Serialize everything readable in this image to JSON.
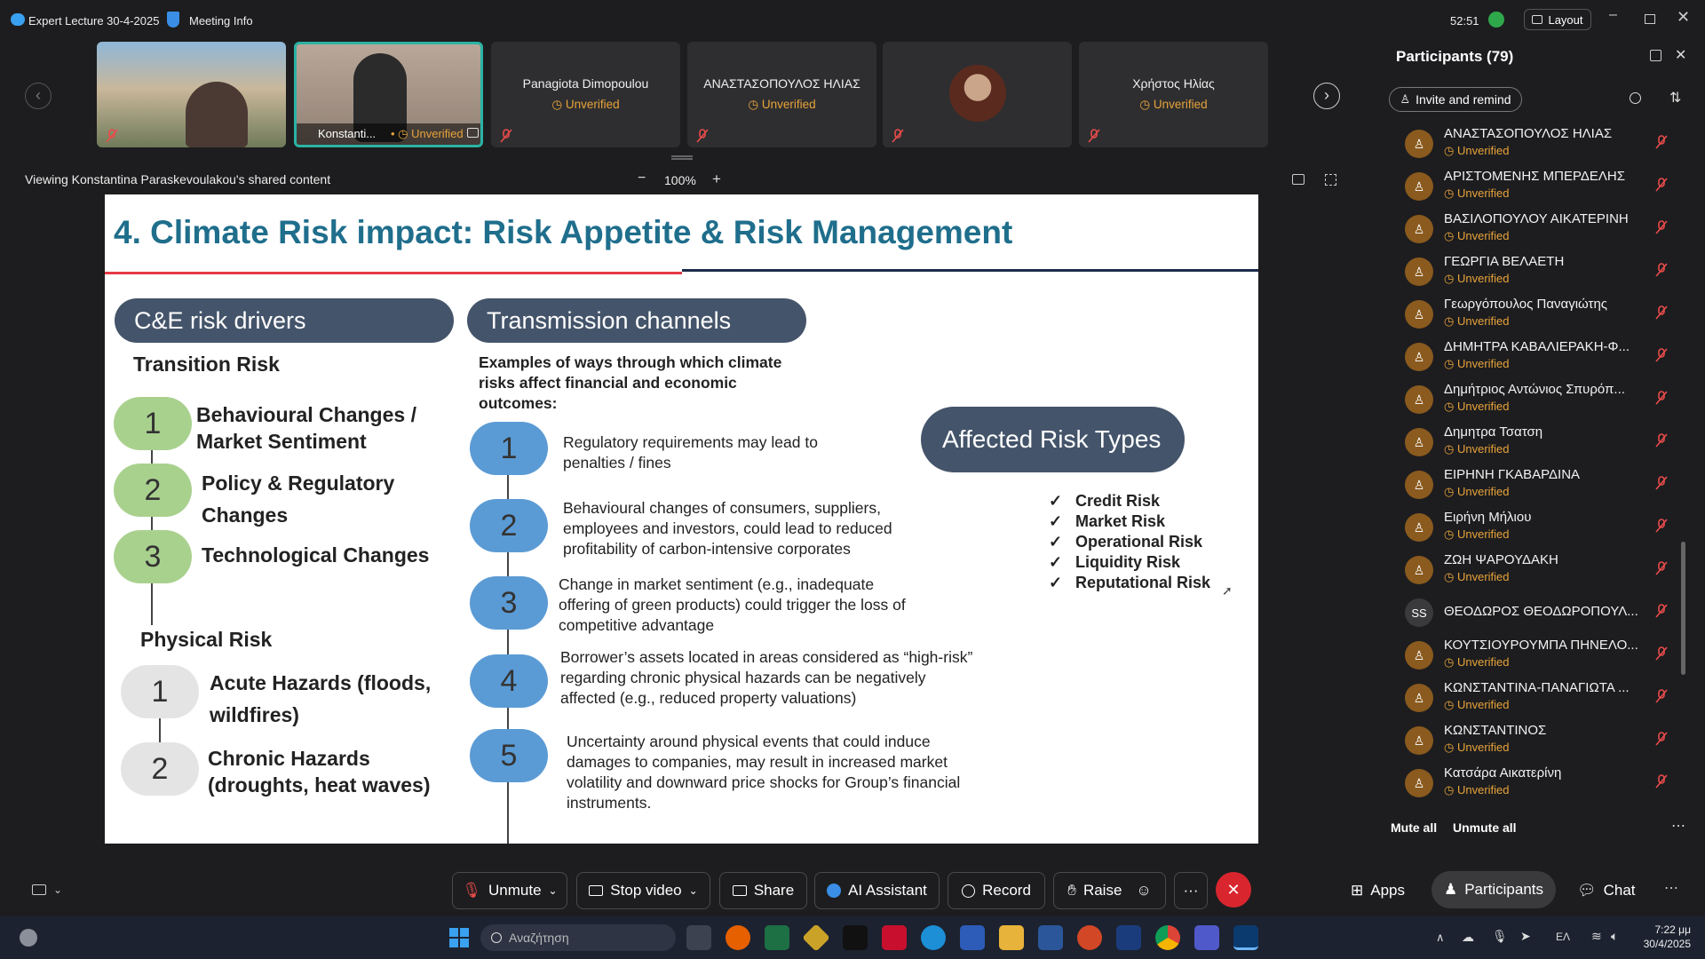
{
  "titlebar": {
    "app_title": "Expert Lecture 30-4-2025",
    "meeting_info": "Meeting Info",
    "timer": "52:51",
    "layout": "Layout"
  },
  "tiles": [
    {
      "name": ""
    },
    {
      "name": "Konstanti...",
      "status": "Unverified"
    },
    {
      "name": "Panagiota Dimopoulou",
      "status": "Unverified"
    },
    {
      "name": "ΑΝΑΣΤΑΣΟΠΟΥΛΟΣ ΗΛΙΑΣ",
      "status": "Unverified"
    },
    {
      "name": ""
    },
    {
      "name": "Χρήστος Ηλίας",
      "status": "Unverified"
    }
  ],
  "share": {
    "viewing": "Viewing Konstantina Paraskevoulakou's shared content",
    "zoom": "100%",
    "minus": "−",
    "plus": "+"
  },
  "slide": {
    "title": "4. Climate Risk impact: Risk Appetite & Risk Management",
    "drivers_header": "C&E risk drivers",
    "transition_title": "Transition Risk",
    "transition": [
      {
        "num": "1",
        "l1": "Behavioural Changes /",
        "l2": "Market Sentiment"
      },
      {
        "num": "2",
        "l1": "Policy & Regulatory",
        "l2": "Changes"
      },
      {
        "num": "3",
        "l1": "Technological Changes",
        "l2": ""
      }
    ],
    "physical_title": "Physical Risk",
    "physical": [
      {
        "num": "1",
        "l1": "Acute Hazards (floods,",
        "l2": "wildfires)"
      },
      {
        "num": "2",
        "l1": "Chronic Hazards",
        "l2": "(droughts, heat waves)"
      }
    ],
    "channels_header": "Transmission channels",
    "examples": "Examples of ways through which climate risks affect financial and economic outcomes:",
    "channels": [
      {
        "num": "1",
        "text": "Regulatory requirements may lead to penalties / fines"
      },
      {
        "num": "2",
        "text": "Behavioural changes of consumers, suppliers, employees and investors, could lead to reduced profitability of carbon-intensive corporates"
      },
      {
        "num": "3",
        "text": "Change in market sentiment (e.g., inadequate offering of green products) could trigger the loss of competitive advantage"
      },
      {
        "num": "4",
        "text": "Borrower’s assets located in areas considered as “high-risk” regarding chronic physical hazards can be negatively affected (e.g., reduced property valuations)"
      },
      {
        "num": "5",
        "text": "Uncertainty around physical events that could induce damages to companies, may result in increased market volatility and downward price shocks for Group’s financial instruments."
      }
    ],
    "affected_header": "Affected Risk Types",
    "risk_types": [
      "Credit Risk",
      "Market Risk",
      "Operational Risk",
      "Liquidity Risk",
      "Reputational Risk"
    ]
  },
  "participants": {
    "title": "Participants (79)",
    "invite": "Invite and remind",
    "list": [
      {
        "name": "ΑΝΑΣΤΑΣΟΠΟΥΛΟΣ ΗΛΙΑΣ",
        "status": "Unverified"
      },
      {
        "name": "ΑΡΙΣΤΟΜΕΝΗΣ ΜΠΕΡΔΕΛΗΣ",
        "status": "Unverified"
      },
      {
        "name": "ΒΑΣΙΛΟΠΟΥΛΟΥ ΑΙΚΑΤΕΡΙΝΗ",
        "status": "Unverified"
      },
      {
        "name": "ΓΕΩΡΓΙΑ ΒΕΛΑΕΤΗ",
        "status": "Unverified"
      },
      {
        "name": "Γεωργόπουλος Παναγιώτης",
        "status": "Unverified"
      },
      {
        "name": "ΔΗΜΗΤΡΑ ΚΑΒΑΛΙΕΡΑΚΗ-Φ...",
        "status": "Unverified"
      },
      {
        "name": "Δημήτριος Αντώνιος Σπυρόπ...",
        "status": "Unverified"
      },
      {
        "name": "Δημητρα Τσατση",
        "status": "Unverified"
      },
      {
        "name": "ΕΙΡΗΝΗ ΓΚΑΒΑΡΔΙΝΑ",
        "status": "Unverified"
      },
      {
        "name": "Ειρήνη Μήλιου",
        "status": "Unverified"
      },
      {
        "name": "ΖΩΗ ΨΑΡΟΥΔΑΚΗ",
        "status": "Unverified"
      },
      {
        "name": "ΘΕΟΔΩΡΟΣ ΘΕΟΔΩΡΟΠΟΥΛ...",
        "status": "",
        "initials": "SS"
      },
      {
        "name": "ΚΟΥΤΣΙΟΥΡΟΥΜΠΑ ΠΗΝΕΛΟ...",
        "status": "Unverified"
      },
      {
        "name": "ΚΩΝΣΤΑΝΤΙΝΑ-ΠΑΝΑΓΙΩΤΑ ...",
        "status": "Unverified"
      },
      {
        "name": "ΚΩΝΣΤΑΝΤΙΝΟΣ",
        "status": "Unverified"
      },
      {
        "name": "Κατσάρα Αικατερίνη",
        "status": "Unverified"
      }
    ],
    "mute_all": "Mute all",
    "unmute_all": "Unmute all"
  },
  "controls": {
    "unmute": "Unmute",
    "stop_video": "Stop video",
    "share": "Share",
    "ai_assistant": "AI Assistant",
    "record": "Record",
    "raise": "Raise",
    "more": "···",
    "apps": "Apps",
    "participants": "Participants",
    "chat": "Chat"
  },
  "taskbar": {
    "search_placeholder": "Αναζήτηση",
    "lang": "ΕΛ",
    "time": "7:22 μμ",
    "date": "30/4/2025"
  },
  "colors": {
    "slide_title": "#1f6e8c",
    "pill": "#44546a",
    "green": "#a9d18e",
    "blue": "#5b9bd5",
    "unverified": "#e8a33a",
    "end_call": "#d9262e"
  }
}
